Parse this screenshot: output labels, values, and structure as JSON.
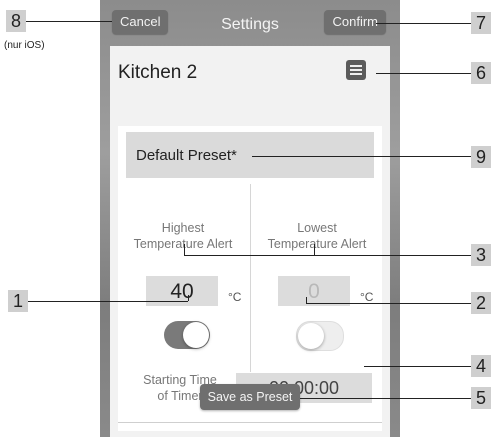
{
  "nav": {
    "cancel_label": "Cancel",
    "title": "Settings",
    "confirm_label": "Confirm"
  },
  "device_name": "Kitchen 2",
  "preset": {
    "name": "Default Preset*"
  },
  "high_alert": {
    "label_line1": "Highest",
    "label_line2": "Temperature Alert",
    "value": "40",
    "unit": "°C",
    "enabled": true
  },
  "low_alert": {
    "label_line1": "Lowest",
    "label_line2": "Temperature Alert",
    "value": "0",
    "unit": "°C",
    "enabled": false
  },
  "timer": {
    "label_line1": "Starting Time",
    "label_line2": "of Timer",
    "value": "00:00:00"
  },
  "save_label": "Save as Preset",
  "ios_note": "(nur iOS)",
  "callouts": {
    "c1": "1",
    "c2": "2",
    "c3": "3",
    "c4": "4",
    "c5": "5",
    "c6": "6",
    "c7": "7",
    "c8": "8",
    "c9": "9"
  },
  "colors": {
    "toggle_on": "#7a7a7a",
    "toggle_off": "#eeeeee",
    "nav_button": "#6f6f6f"
  }
}
